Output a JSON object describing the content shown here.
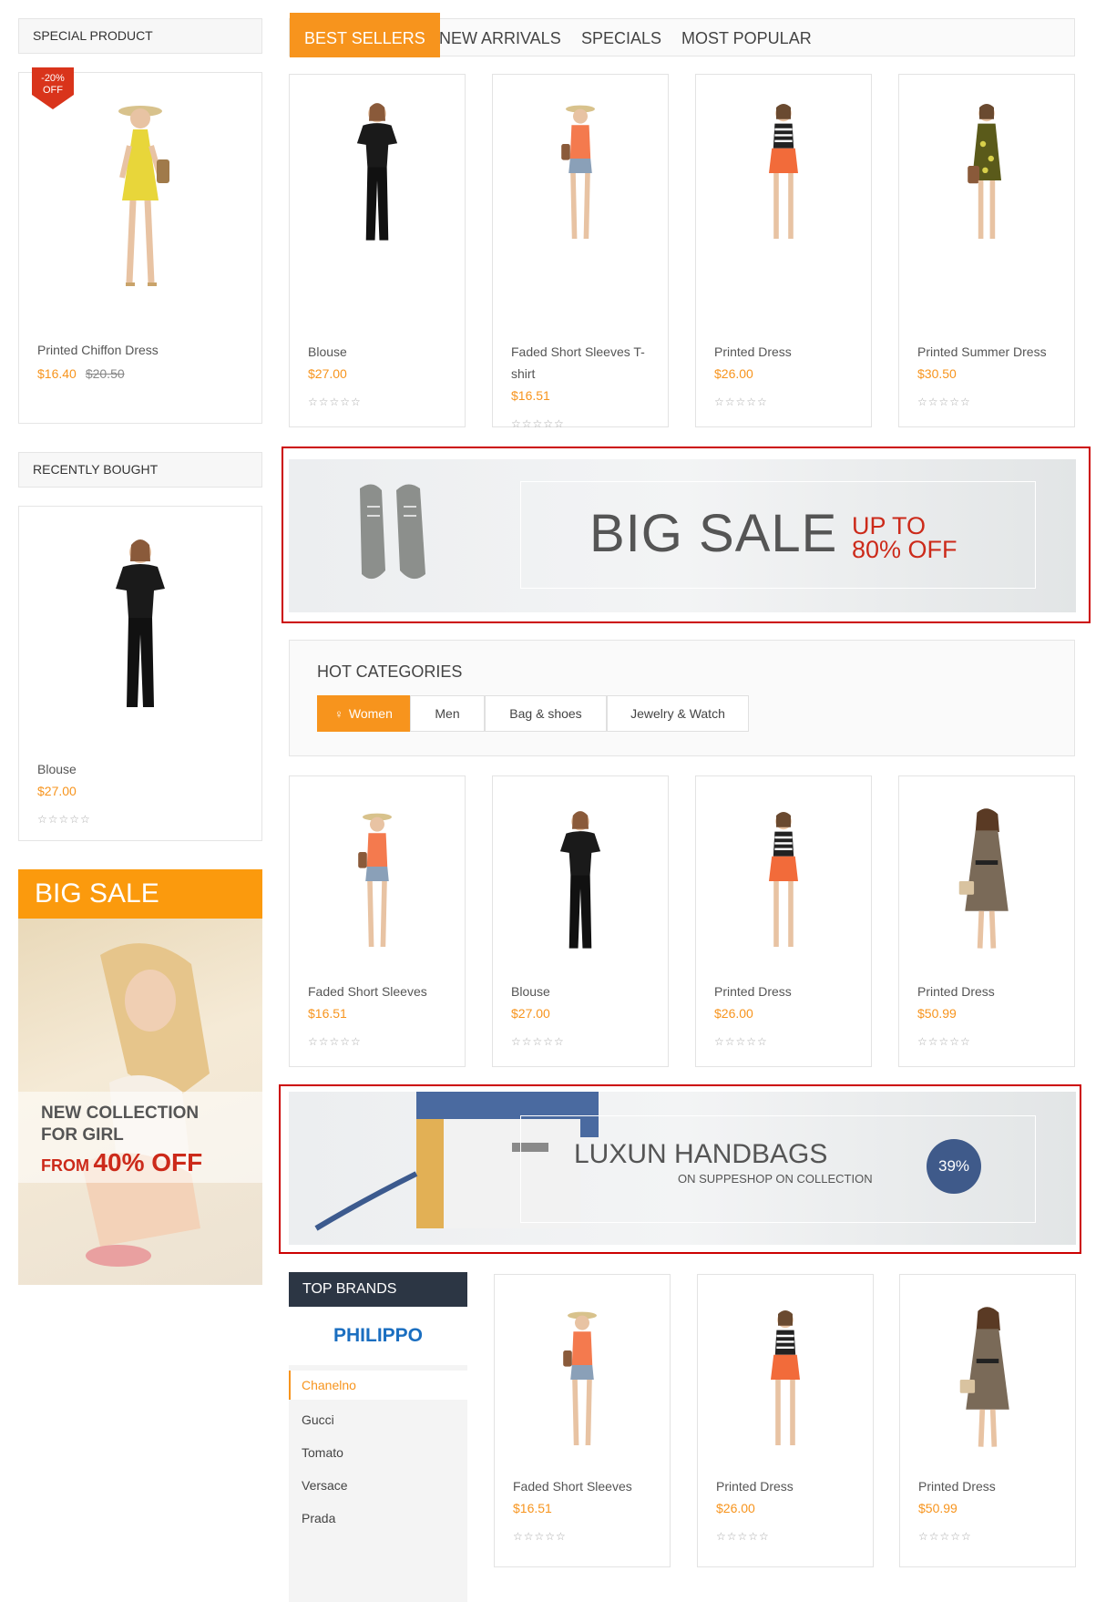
{
  "special": {
    "title": "SPECIAL PRODUCT",
    "badge_pct": "-20%",
    "badge_off": "OFF",
    "name": "Printed Chiffon Dress",
    "price": "$16.40",
    "old_price": "$20.50"
  },
  "recent": {
    "title": "RECENTLY BOUGHT",
    "name": "Blouse",
    "price": "$27.00",
    "stars": "☆☆☆☆☆"
  },
  "tabs": [
    "BEST SELLERS",
    "NEW ARRIVALS",
    "SPECIALS",
    "MOST POPULAR"
  ],
  "best": [
    {
      "name": "Blouse",
      "price": "$27.00",
      "stars": "☆☆☆☆☆"
    },
    {
      "name": "Faded Short Sleeves T-shirt",
      "price": "$16.51",
      "stars": "☆☆☆☆☆"
    },
    {
      "name": "Printed Dress",
      "price": "$26.00",
      "stars": "☆☆☆☆☆"
    },
    {
      "name": "Printed Summer Dress",
      "price": "$30.50",
      "stars": "☆☆☆☆☆"
    }
  ],
  "banner1": {
    "big": "BIG SALE",
    "up1": "UP TO",
    "up2": "80% OFF"
  },
  "hot": {
    "title": "HOT CATEGORIES",
    "cats": [
      "Women",
      "Men",
      "Bag & shoes",
      "Jewelry & Watch"
    ]
  },
  "cat_products": [
    {
      "name": "Faded Short Sleeves",
      "price": "$16.51",
      "stars": "☆☆☆☆☆"
    },
    {
      "name": "Blouse",
      "price": "$27.00",
      "stars": "☆☆☆☆☆"
    },
    {
      "name": "Printed Dress",
      "price": "$26.00",
      "stars": "☆☆☆☆☆"
    },
    {
      "name": "Printed Dress",
      "price": "$50.99",
      "stars": "☆☆☆☆☆"
    }
  ],
  "banner2": {
    "title": "LUXUN HANDBAGS",
    "sub": "ON SUPPESHOP ON COLLECTION",
    "pct": "39%"
  },
  "bigsale": {
    "head": "BIG SALE",
    "line1": "NEW COLLECTION",
    "line2": "FOR GIRL",
    "from": "FROM",
    "pct": "40% OFF"
  },
  "brands": {
    "title": "TOP BRANDS",
    "logo": "PHILIPPO",
    "items": [
      "Chanelno",
      "Gucci",
      "Tomato",
      "Versace",
      "Prada"
    ]
  },
  "brand_products": [
    {
      "name": "Faded Short Sleeves",
      "price": "$16.51",
      "stars": "☆☆☆☆☆"
    },
    {
      "name": "Printed Dress",
      "price": "$26.00",
      "stars": "☆☆☆☆☆"
    },
    {
      "name": "Printed Dress",
      "price": "$50.99",
      "stars": "☆☆☆☆☆"
    }
  ],
  "colors": {
    "accent": "#f7941d",
    "dark": "#2c3644",
    "sale_red": "#cc2a1a",
    "banner_blue": "#3f5a8a"
  }
}
